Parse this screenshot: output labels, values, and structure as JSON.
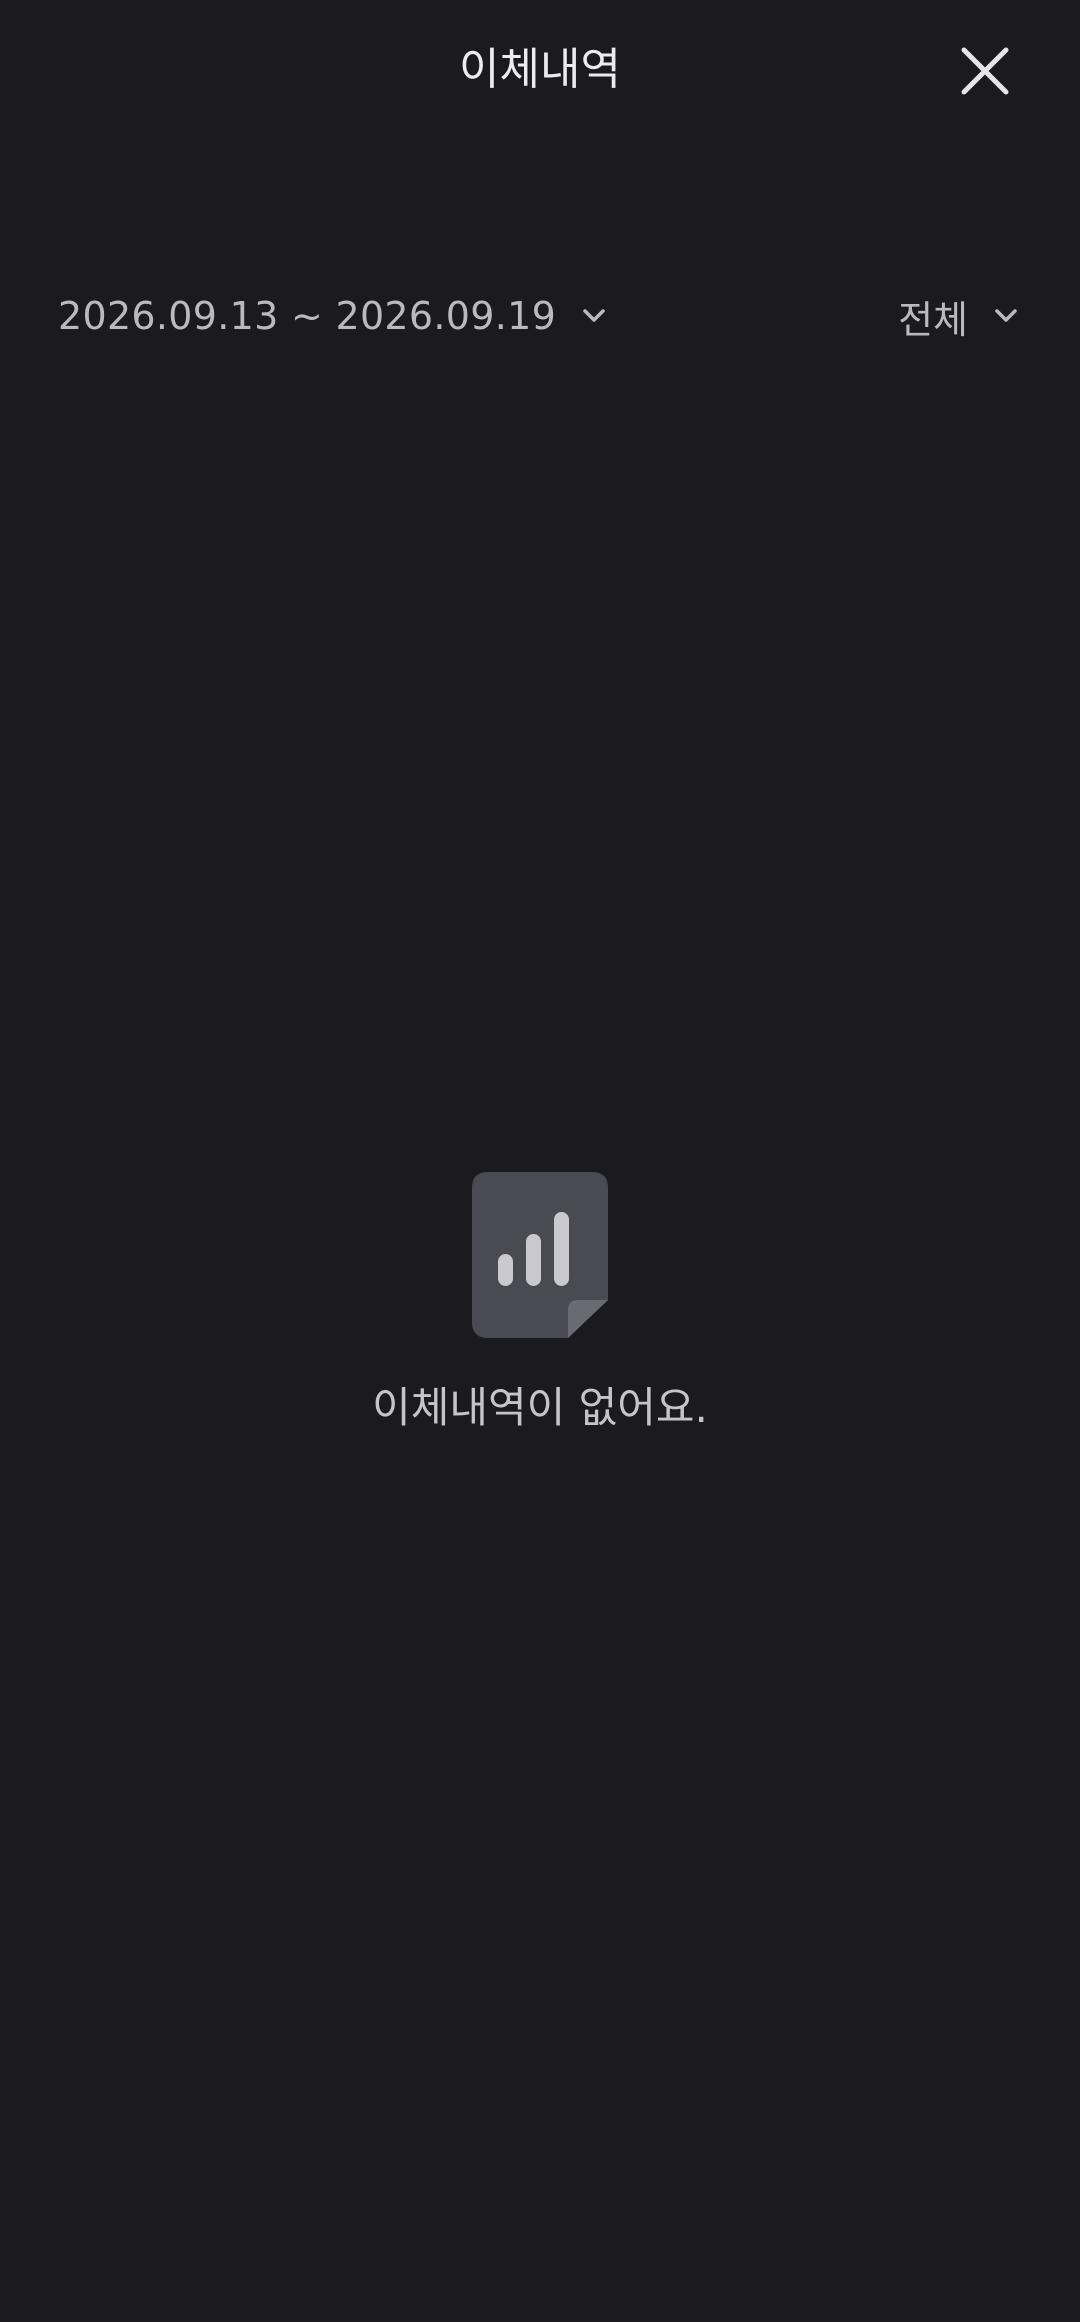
{
  "header": {
    "title": "이체내역",
    "close_icon": "close-icon"
  },
  "filters": {
    "date_range": "2026.09.13 ~ 2026.09.19",
    "type": "전체",
    "dropdown_icon": "chevron-down-icon"
  },
  "empty_state": {
    "icon": "document-chart-icon",
    "message": "이체내역이 없어요."
  },
  "colors": {
    "background": "#1b1a1f",
    "title_text": "#ececef",
    "secondary_text": "#b9b9c0",
    "icon_body": "#4a4a53",
    "icon_bars": "#c9c9cf"
  }
}
